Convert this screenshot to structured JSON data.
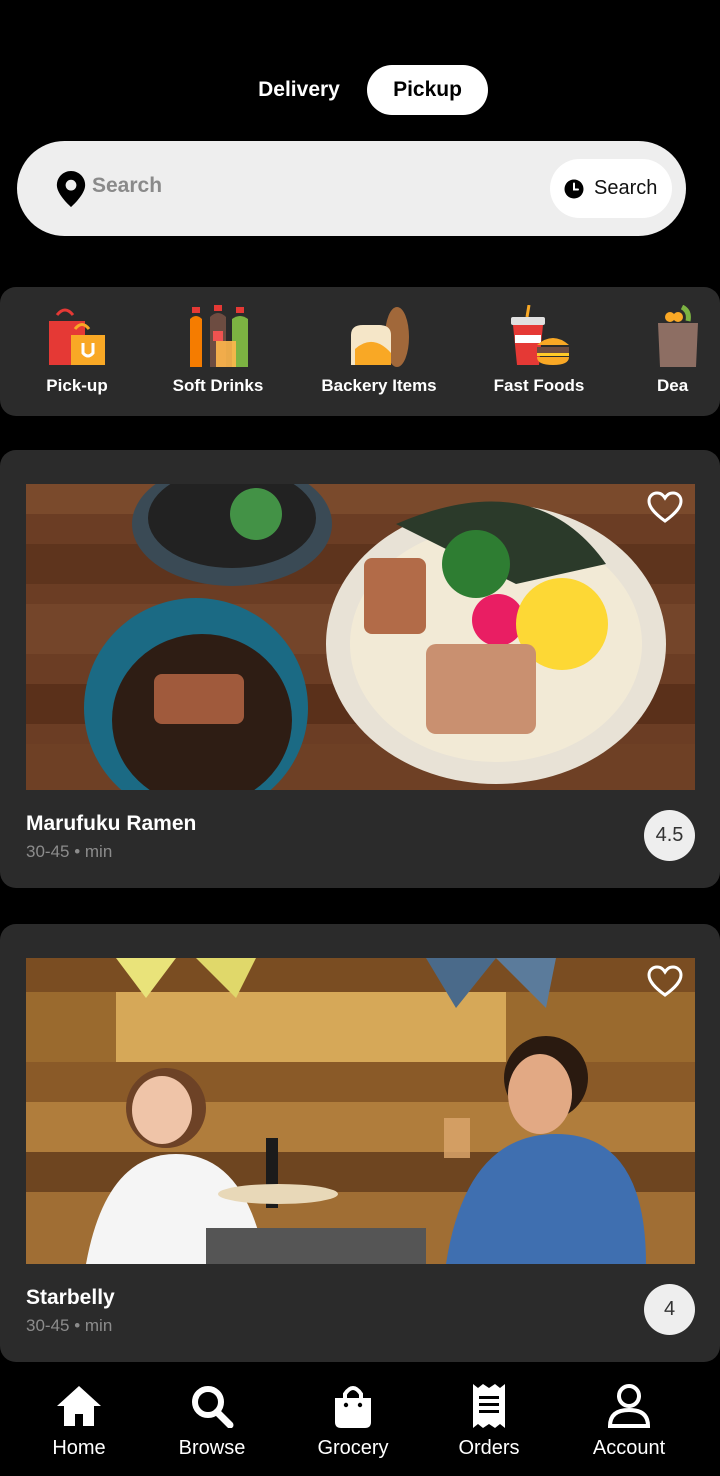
{
  "mode_toggle": {
    "delivery_label": "Delivery",
    "pickup_label": "Pickup",
    "selected": "Pickup"
  },
  "search": {
    "placeholder": "Search",
    "button_label": "Search"
  },
  "categories": [
    {
      "label": "Pick-up",
      "icon": "shopping-bags-icon"
    },
    {
      "label": "Soft Drinks",
      "icon": "soda-bottles-icon"
    },
    {
      "label": "Backery Items",
      "icon": "bread-icon"
    },
    {
      "label": "Fast Foods",
      "icon": "burger-drink-icon"
    },
    {
      "label": "Dea",
      "icon": "grocery-bag-icon"
    }
  ],
  "restaurants": [
    {
      "name": "Marufuku Ramen",
      "eta": "30-45 • min",
      "rating": "4.5",
      "favorite_icon": "heart-outline-icon"
    },
    {
      "name": "Starbelly",
      "eta": "30-45 • min",
      "rating": "4",
      "favorite_icon": "heart-outline-icon"
    }
  ],
  "navbar": [
    {
      "label": "Home",
      "icon": "home-icon"
    },
    {
      "label": "Browse",
      "icon": "search-icon"
    },
    {
      "label": "Grocery",
      "icon": "shopping-bag-icon"
    },
    {
      "label": "Orders",
      "icon": "receipt-icon"
    },
    {
      "label": "Account",
      "icon": "user-icon"
    }
  ],
  "colors": {
    "background": "#000000",
    "card": "#2b2b2b",
    "search_bg": "#eeeeee",
    "rating_bg": "#eeeeee"
  }
}
